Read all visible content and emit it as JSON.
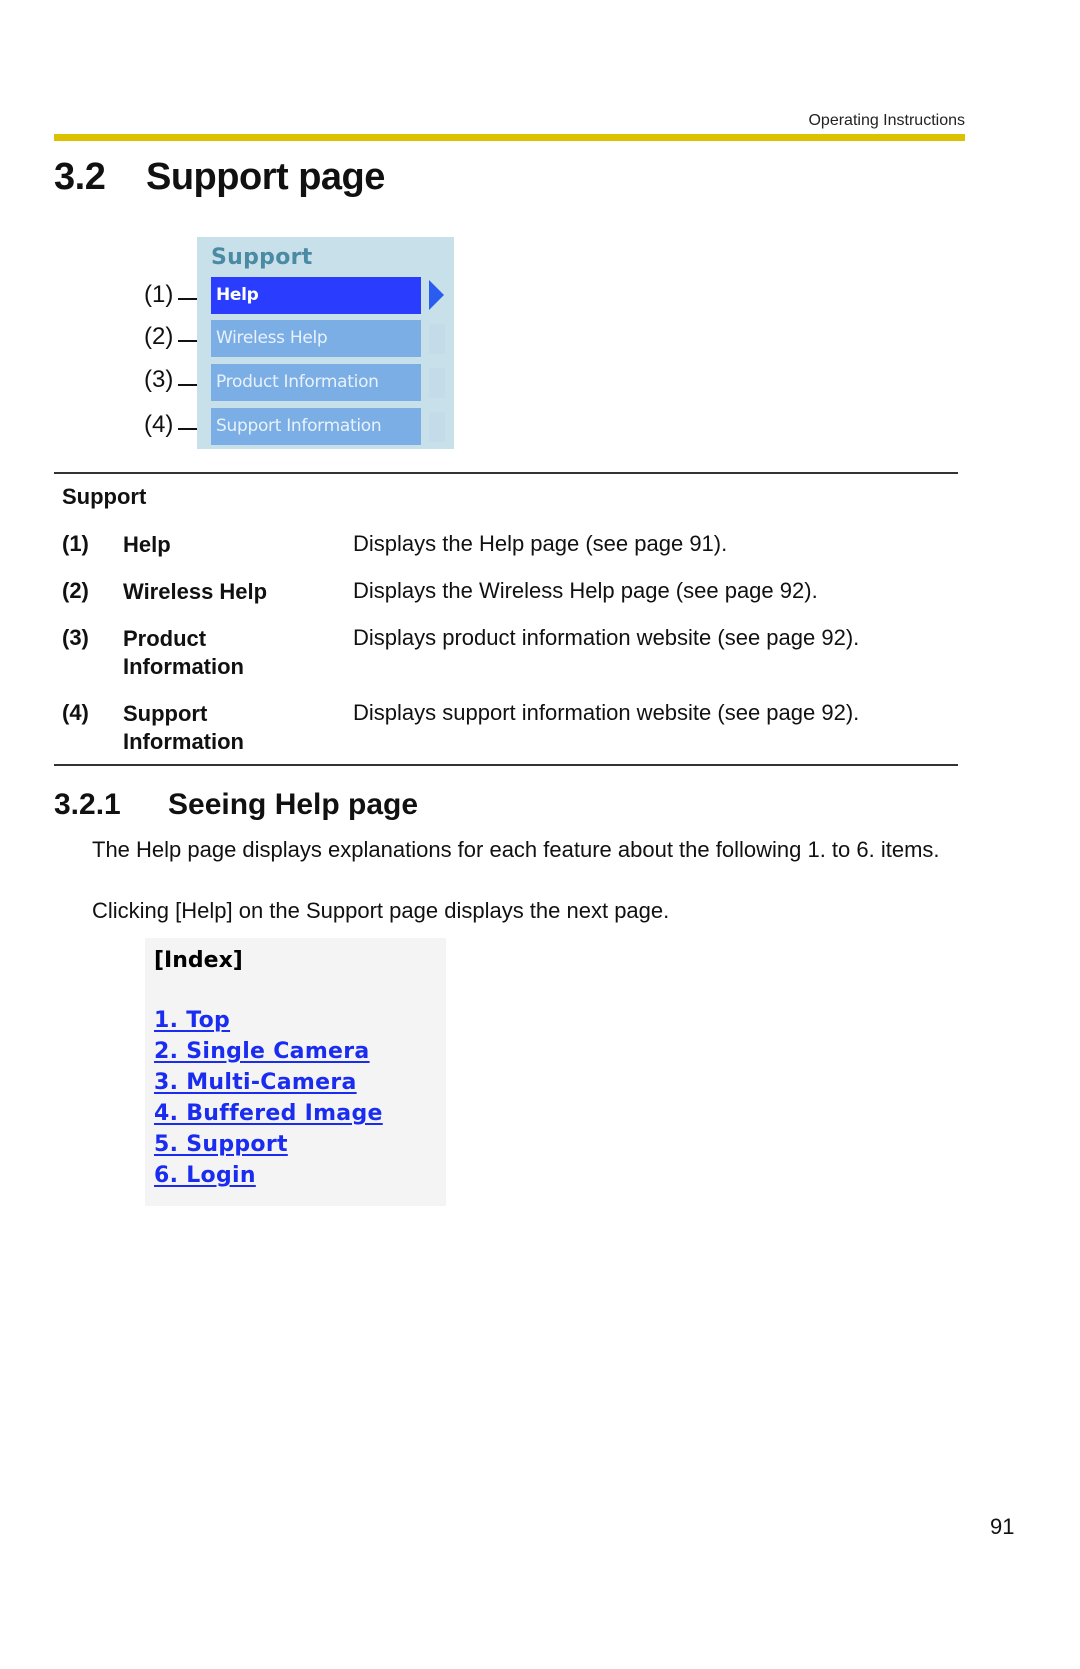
{
  "header": {
    "running_title": "Operating Instructions",
    "accent_color": "#dcc100"
  },
  "section": {
    "number": "3.2",
    "title": "Support page"
  },
  "support_menu": {
    "heading": "Support",
    "items": [
      {
        "callout": "(1)",
        "label": "Help",
        "active": true
      },
      {
        "callout": "(2)",
        "label": "Wireless Help",
        "active": false
      },
      {
        "callout": "(3)",
        "label": "Product Information",
        "active": false
      },
      {
        "callout": "(4)",
        "label": "Support Information",
        "active": false
      }
    ],
    "colors": {
      "panel": "#c8e0ea",
      "active": "#2a3dff",
      "inactive": "#7baee4",
      "heading": "#4a8aa3"
    }
  },
  "definitions": {
    "heading": "Support",
    "rows": [
      {
        "index": "(1)",
        "term_line1": "Help",
        "term_line2": "",
        "description": "Displays the Help page (see page 91)."
      },
      {
        "index": "(2)",
        "term_line1": "Wireless Help",
        "term_line2": "",
        "description": "Displays the Wireless Help page (see page 92)."
      },
      {
        "index": "(3)",
        "term_line1": "Product",
        "term_line2": "Information",
        "description": "Displays product information website (see page 92)."
      },
      {
        "index": "(4)",
        "term_line1": "Support",
        "term_line2": "Information",
        "description": "Displays support information website (see page 92)."
      }
    ]
  },
  "subsection": {
    "number": "3.2.1",
    "title": "Seeing Help page",
    "paragraph1": "The Help page displays explanations for each feature about the following 1. to 6. items.",
    "paragraph2": "Clicking [Help] on the Support page displays the next page."
  },
  "help_index": {
    "heading": "[Index]",
    "links": [
      "1. Top",
      "2. Single Camera",
      "3. Multi-Camera",
      "4. Buffered Image",
      "5. Support",
      "6. Login"
    ],
    "link_color": "#1a2cf0"
  },
  "footer": {
    "page_number": "91"
  }
}
